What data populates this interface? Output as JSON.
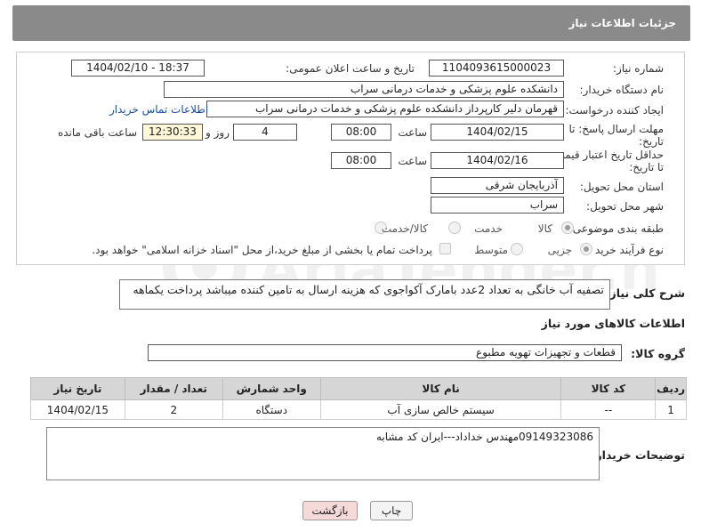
{
  "header": {
    "title": "جزئیات اطلاعات نیاز"
  },
  "form": {
    "need_number": {
      "label": "شماره نیاز:",
      "value": "1104093615000023"
    },
    "announce_datetime": {
      "label": "تاریخ و ساعت اعلان عمومی:",
      "value": "1404/02/10 - 18:37"
    },
    "buyer_org": {
      "label": "نام دستگاه خریدار:",
      "value": "دانشکده علوم پزشکی و خدمات درمانی سراب"
    },
    "creator": {
      "label": "ایجاد کننده درخواست:",
      "value": "قهرمان دلیر کارپرداز دانشکده علوم پزشکی و خدمات درمانی سراب",
      "contact_link": "اطلاعات تماس خریدار"
    },
    "reply_deadline": {
      "label_line1": "مهلت ارسال پاسخ: تا",
      "label_line2": "تاریخ:",
      "date": "1404/02/15",
      "time_label": "ساعت",
      "time": "08:00",
      "days": "4",
      "days_label": "روز و",
      "remaining_time": "12:30:33",
      "remaining_label": "ساعت باقی مانده"
    },
    "price_validity": {
      "label_line1": "حداقل تاریخ اعتبار قیمت:",
      "label_line2": "تا تاریخ:",
      "date": "1404/02/16",
      "time_label": "ساعت",
      "time": "08:00"
    },
    "delivery_province": {
      "label": "استان محل تحویل:",
      "value": "آذربایجان شرقی"
    },
    "delivery_city": {
      "label": "شهر محل تحویل:",
      "value": "سراب"
    },
    "category": {
      "label": "طبقه بندی موضوعی:",
      "options": [
        "کالا",
        "خدمت",
        "کالا/خدمت"
      ],
      "selected": "کالا"
    },
    "purchase_type": {
      "label": "نوع فرآیند خرید :",
      "options": [
        "جزیی",
        "متوسط"
      ],
      "selected": "جزیی",
      "payment_note": "پرداخت تمام یا بخشی از مبلغ خرید،از محل \"اسناد خزانه اسلامی\" خواهد بود."
    }
  },
  "description": {
    "label": "شرح کلی نیاز:",
    "value": "تصفیه آب خانگی به تعداد 2عدد بامارک آکواجوی که هزینه ارسال به تامین کننده میباشد پرداخت یکماهه"
  },
  "goods_section": {
    "title": "اطلاعات کالاهای مورد نیاز"
  },
  "goods_group": {
    "label": "گروه کالا:",
    "value": "قطعات و تجهیزات تهویه مطبوع"
  },
  "table": {
    "headers": [
      "ردیف",
      "کد کالا",
      "نام کالا",
      "واحد شمارش",
      "تعداد / مقدار",
      "تاریخ نیاز"
    ],
    "rows": [
      [
        "1",
        "--",
        "سیستم خالص سازی آب",
        "دستگاه",
        "2",
        "1404/02/15"
      ]
    ]
  },
  "buyer_notes": {
    "label": "توضیحات خریدار:",
    "value": "09149323086مهندس خداداد---ایران کد مشابه"
  },
  "buttons": {
    "print": "چاپ",
    "back": "بازگشت"
  },
  "colors": {
    "header_bg": "#8a8a8a",
    "link": "#1a4fa3",
    "back_button_bg": "#f6d9d9"
  }
}
